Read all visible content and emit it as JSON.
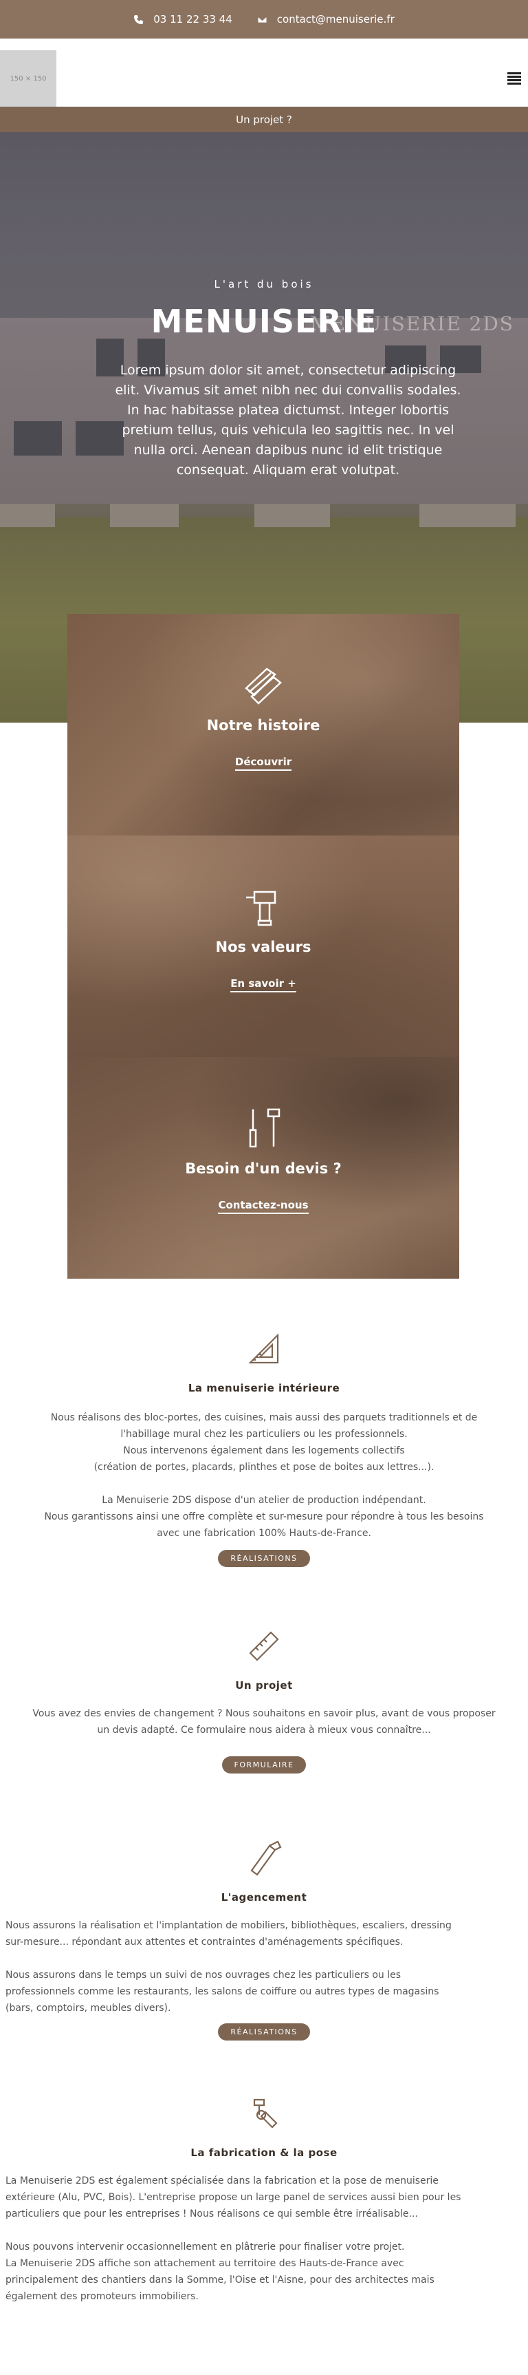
{
  "topbar": {
    "phone": "03 11 22 33 44",
    "email": "contact@menuiserie.fr",
    "phone_icon": "phone-icon",
    "email_icon": "envelope-icon"
  },
  "header": {
    "logo_placeholder": "150 × 150",
    "menu_icon": "hamburger-icon"
  },
  "projet_bar": {
    "label": "Un projet ?"
  },
  "hero": {
    "subtitle": "L'art du bois",
    "title": "MENUISERIE",
    "sign_text": "MENUISERIE 2DS",
    "text": "Lorem ipsum dolor sit amet, consectetur adipiscing elit. Vivamus sit amet nibh nec dui convallis sodales. In hac habitasse platea dictumst. Integer lobortis pretium tellus, quis vehicula leo sagittis nec. In vel nulla orci. Aenean dapibus nunc id elit tristique consequat. Aliquam erat volutpat."
  },
  "cards": [
    {
      "icon": "wood-planks-icon",
      "title": "Notre histoire",
      "link": "Découvrir"
    },
    {
      "icon": "drill-icon",
      "title": "Nos valeurs",
      "link": "En savoir +"
    },
    {
      "icon": "tools-icon",
      "title": "Besoin d'un devis ?",
      "link": "Contactez-nous"
    }
  ],
  "sections": {
    "interieure": {
      "icon": "set-square-icon",
      "title": "La menuiserie intérieure",
      "p1_l1": "Nous réalisons des bloc-portes, des cuisines, mais aussi des parquets traditionnels et de",
      "p1_l2": "l'habillage mural chez les particuliers ou les professionnels.",
      "p1_l3": "Nous intervenons également dans les logements collectifs",
      "p1_l4": "(création de portes, placards, plinthes et pose de boites aux lettres...).",
      "p2_l1": "La Menuiserie 2DS dispose d'un atelier de production indépendant.",
      "p2_l2": "Nous garantissons ainsi une offre complète et sur-mesure pour répondre à tous les besoins",
      "p2_l3": "avec une fabrication 100% Hauts-de-France.",
      "button": "RÉALISATIONS"
    },
    "projet": {
      "icon": "ruler-icon",
      "title": "Un projet",
      "p_l1": "Vous avez des envies de changement ? Nous souhaitons en savoir plus, avant de vous proposer",
      "p_l2": "un devis adapté. Ce formulaire nous aidera à mieux vous connaître...",
      "button": "FORMULAIRE"
    },
    "agencement": {
      "icon": "saw-icon",
      "title": "L'agencement",
      "p1_l1": "Nous assurons la réalisation et l'implantation de mobiliers, bibliothèques, escaliers, dressing",
      "p1_l2": "sur-mesure... répondant aux attentes et contraintes d'aménagements spécifiques.",
      "p2_l1": "Nous assurons dans le temps un suivi de nos ouvrages chez les particuliers ou les",
      "p2_l2": "professionnels comme les restaurants, les salons de coiffure ou autres types de magasins",
      "p2_l3": "(bars, comptoirs, meubles divers).",
      "button": "RÉALISATIONS"
    },
    "fabrication": {
      "icon": "hammer-wrench-icon",
      "title": "La fabrication & la pose",
      "p1_l1": "La Menuiserie 2DS est également spécialisée dans la fabrication et la pose de menuiserie",
      "p1_l2": "extérieure (Alu, PVC, Bois). L'entreprise propose un large panel de services aussi bien pour les",
      "p1_l3": "particuliers que pour les entreprises ! Nous réalisons ce qui semble être irréalisable...",
      "p2_l1": "Nous pouvons intervenir occasionnellement en plâtrerie pour finaliser votre projet.",
      "p2_l2": "La Menuiserie 2DS affiche son attachement au territoire des Hauts-de-France avec",
      "p2_l3": "principalement des chantiers dans la Somme, l'Oise et l'Aisne, pour des architectes mais",
      "p2_l4": "également des promoteurs immobiliers."
    }
  }
}
